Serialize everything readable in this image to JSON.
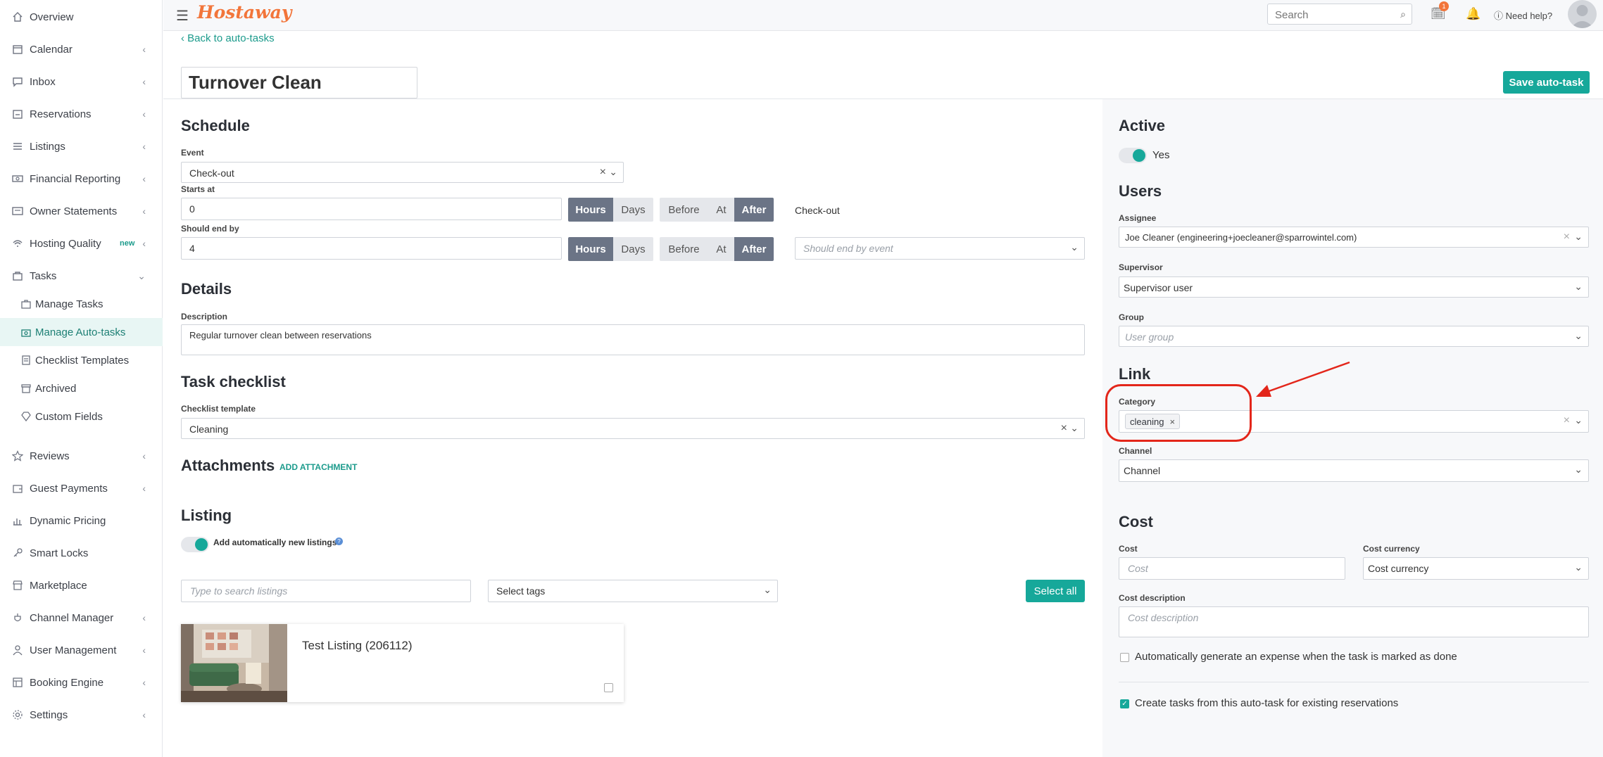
{
  "sidebar": {
    "items": [
      {
        "label": "Overview",
        "icon": "home-icon",
        "chevron": false
      },
      {
        "label": "Calendar",
        "icon": "calendar-icon",
        "chevron": true
      },
      {
        "label": "Inbox",
        "icon": "inbox-icon",
        "chevron": true
      },
      {
        "label": "Reservations",
        "icon": "reservations-icon",
        "chevron": true
      },
      {
        "label": "Listings",
        "icon": "listings-icon",
        "chevron": true
      },
      {
        "label": "Financial Reporting",
        "icon": "money-icon",
        "chevron": true
      },
      {
        "label": "Owner Statements",
        "icon": "statement-icon",
        "chevron": true
      },
      {
        "label": "Hosting Quality",
        "icon": "quality-icon",
        "chevron": true,
        "badge": "new"
      },
      {
        "label": "Tasks",
        "icon": "tasks-icon",
        "chevron": true
      }
    ],
    "tasks_sub": [
      {
        "label": "Manage Tasks",
        "icon": "briefcase-icon"
      },
      {
        "label": "Manage Auto-tasks",
        "icon": "auto-task-icon",
        "active": true
      },
      {
        "label": "Checklist Templates",
        "icon": "checklist-icon"
      },
      {
        "label": "Archived",
        "icon": "archive-icon"
      },
      {
        "label": "Custom Fields",
        "icon": "diamond-icon"
      }
    ],
    "items_after": [
      {
        "label": "Reviews",
        "icon": "star-icon",
        "chevron": true
      },
      {
        "label": "Guest Payments",
        "icon": "wallet-icon",
        "chevron": true
      },
      {
        "label": "Dynamic Pricing",
        "icon": "chart-icon",
        "chevron": false
      },
      {
        "label": "Smart Locks",
        "icon": "key-icon",
        "chevron": false
      },
      {
        "label": "Marketplace",
        "icon": "market-icon",
        "chevron": false
      },
      {
        "label": "Channel Manager",
        "icon": "channel-icon",
        "chevron": true
      },
      {
        "label": "User Management",
        "icon": "user-icon",
        "chevron": true
      },
      {
        "label": "Booking Engine",
        "icon": "booking-icon",
        "chevron": true
      },
      {
        "label": "Settings",
        "icon": "gear-icon",
        "chevron": true
      }
    ]
  },
  "topbar": {
    "logo": "Hostaway",
    "search_placeholder": "Search",
    "notification_count": "1",
    "help": "Need help?"
  },
  "page": {
    "back_link": "Back to auto-tasks",
    "title": "Turnover Clean",
    "save_button": "Save auto-task"
  },
  "schedule": {
    "heading": "Schedule",
    "event_label": "Event",
    "event_value": "Check-out",
    "starts_label": "Starts at",
    "starts_value": "0",
    "ends_label": "Should end by",
    "ends_value": "4",
    "unit_hours": "Hours",
    "unit_days": "Days",
    "rel_before": "Before",
    "rel_at": "At",
    "rel_after": "After",
    "starts_event_text": "Check-out",
    "end_event_placeholder": "Should end by event"
  },
  "details": {
    "heading": "Details",
    "description_label": "Description",
    "description_value": "Regular turnover clean between reservations"
  },
  "checklist": {
    "heading": "Task checklist",
    "template_label": "Checklist template",
    "template_value": "Cleaning"
  },
  "attachments": {
    "heading": "Attachments",
    "add_link": "ADD ATTACHMENT"
  },
  "listing": {
    "heading": "Listing",
    "auto_add_label": "Add automatically new listings",
    "search_placeholder": "Type to search listings",
    "tags_placeholder": "Select tags",
    "select_all": "Select all",
    "card_name": "Test Listing  (206112)"
  },
  "active": {
    "heading": "Active",
    "value": "Yes"
  },
  "users": {
    "heading": "Users",
    "assignee_label": "Assignee",
    "assignee_value": "Joe Cleaner (engineering+joecleaner@sparrowintel.com)",
    "supervisor_label": "Supervisor",
    "supervisor_value": "Supervisor user",
    "group_label": "Group",
    "group_placeholder": "User group"
  },
  "link": {
    "heading": "Link",
    "category_label": "Category",
    "category_tag": "cleaning",
    "channel_label": "Channel",
    "channel_value": "Channel"
  },
  "cost": {
    "heading": "Cost",
    "cost_label": "Cost",
    "cost_placeholder": "Cost",
    "currency_label": "Cost currency",
    "currency_value": "Cost currency",
    "desc_label": "Cost description",
    "desc_placeholder": "Cost description",
    "auto_expense_label": "Automatically generate an expense when the task is marked as done",
    "create_existing_label": "Create tasks from this auto-task for existing reservations"
  },
  "colors": {
    "accent": "#16a89a",
    "annotation": "#e3261a",
    "logo": "#f2753a"
  }
}
